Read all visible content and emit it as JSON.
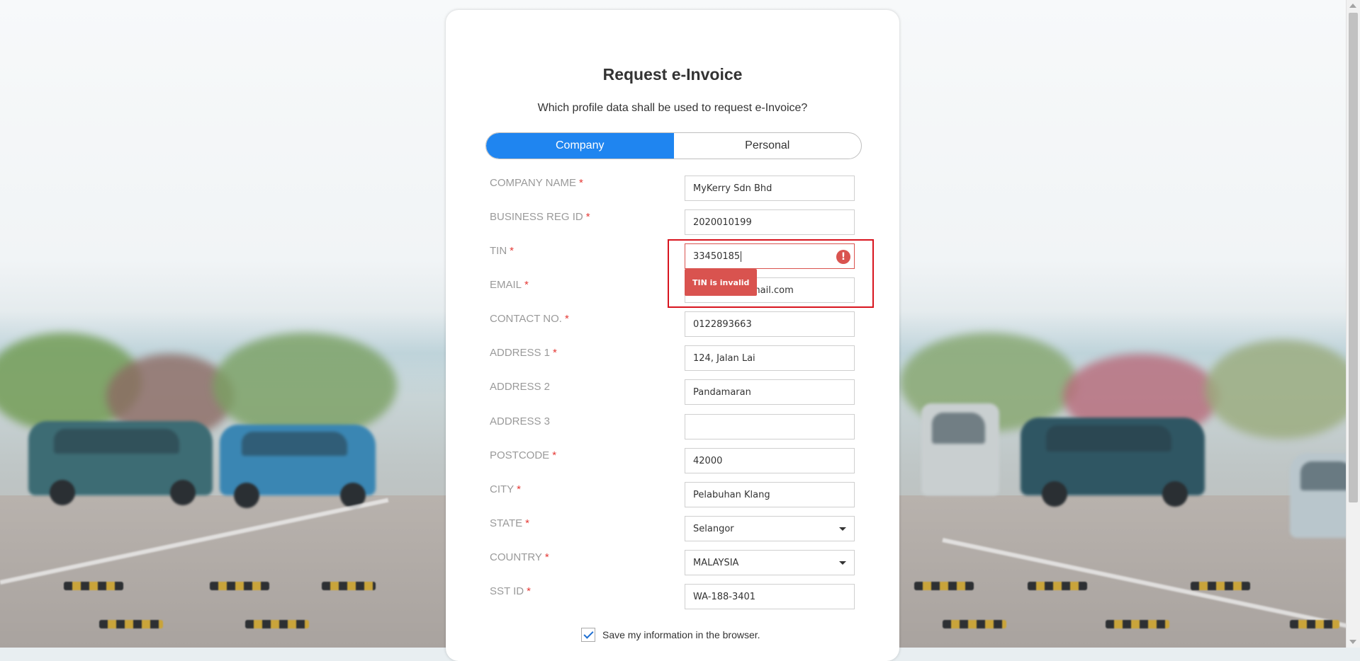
{
  "page": {
    "title": "Request e-Invoice",
    "subtitle": "Which profile data shall be used to request e-Invoice?"
  },
  "profile_toggle": {
    "options": [
      "Company",
      "Personal"
    ],
    "selected": "Company"
  },
  "form": {
    "fields": [
      {
        "label": "COMPANY NAME",
        "required": "*",
        "value": "MyKerry Sdn Bhd"
      },
      {
        "label": "BUSINESS REG ID",
        "required": "*",
        "value": "2020010199"
      },
      {
        "label": "TIN",
        "required": "*",
        "value": "33450185"
      },
      {
        "label": "EMAIL",
        "required": "*",
        "value": "mail.com"
      },
      {
        "label": "CONTACT NO.",
        "required": "*",
        "value": "0122893663"
      },
      {
        "label": "ADDRESS 1",
        "required": "*",
        "value": "124, Jalan Lai"
      },
      {
        "label": "ADDRESS 2",
        "required": "",
        "value": "Pandamaran"
      },
      {
        "label": "ADDRESS 3",
        "required": "",
        "value": ""
      },
      {
        "label": "POSTCODE",
        "required": "*",
        "value": "42000"
      },
      {
        "label": "CITY",
        "required": "*",
        "value": "Pelabuhan Klang"
      },
      {
        "label": "STATE",
        "required": "*",
        "value": "Selangor"
      },
      {
        "label": "COUNTRY",
        "required": "*",
        "value": "MALAYSIA"
      },
      {
        "label": "SST ID",
        "required": "*",
        "value": "WA-188-3401"
      }
    ],
    "tin_error": "TIN is invalid",
    "error_icon_glyph": "!"
  },
  "save_info": {
    "label": "Save my information in the browser.",
    "checked": true
  },
  "colors": {
    "accent": "#1f85f0",
    "error": "#d9534f",
    "highlight_box": "#d8141e",
    "required_star": "#e53935"
  }
}
